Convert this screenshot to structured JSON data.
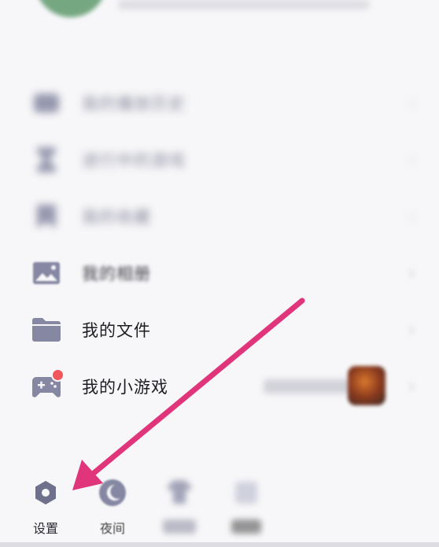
{
  "menu": {
    "items": [
      {
        "label": "我的播放历史",
        "icon": "history-icon"
      },
      {
        "label": "进行中的游戏",
        "icon": "hourglass-icon"
      },
      {
        "label": "我的收藏",
        "icon": "bookmark-icon"
      },
      {
        "label": "我的相册",
        "icon": "image-icon"
      },
      {
        "label": "我的文件",
        "icon": "folder-icon"
      },
      {
        "label": "我的小游戏",
        "icon": "gamepad-icon"
      }
    ]
  },
  "toolbar": {
    "settings_label": "设置",
    "night_label": "夜间",
    "third_label": "",
    "fourth_label": ""
  },
  "colors": {
    "icon": "#8587a3",
    "badge": "#f0565a",
    "arrow": "#e0357a"
  }
}
